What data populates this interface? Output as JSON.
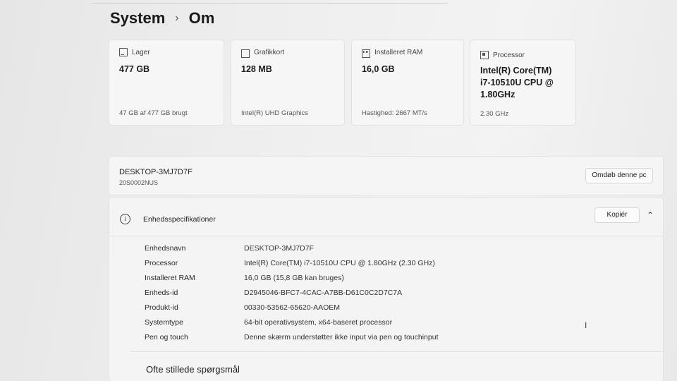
{
  "breadcrumb": {
    "parent": "System",
    "separator": "›",
    "current": "Om"
  },
  "cards": [
    {
      "icon": "drive-icon",
      "label": "Lager",
      "value": "477 GB",
      "sub": "47 GB af 477 GB brugt"
    },
    {
      "icon": "gpu-icon",
      "label": "Grafikkort",
      "value": "128 MB",
      "sub": "Intel(R) UHD Graphics"
    },
    {
      "icon": "ram-icon",
      "label": "Installeret RAM",
      "value": "16,0 GB",
      "sub": "Hastighed: 2667 MT/s"
    },
    {
      "icon": "cpu-icon",
      "label": "Processor",
      "value_lines": [
        "Intel(R) Core(TM)",
        "i7-10510U CPU @",
        "1.80GHz"
      ],
      "sub": "2.30 GHz"
    }
  ],
  "device": {
    "name": "DESKTOP-3MJ7D7F",
    "model": "20S0002NUS",
    "rename_label": "Omdøb denne pc"
  },
  "specs": {
    "title": "Enhedsspecifikationer",
    "copy_label": "Kopiér",
    "rows": [
      {
        "key": "Enhedsnavn",
        "value": "DESKTOP-3MJ7D7F"
      },
      {
        "key": "Processor",
        "value": "Intel(R) Core(TM) i7-10510U CPU @ 1.80GHz (2.30 GHz)"
      },
      {
        "key": "Installeret RAM",
        "value": "16,0 GB (15,8 GB kan bruges)"
      },
      {
        "key": "Enheds-id",
        "value": "D2945046-BFC7-4CAC-A7BB-D61C0C2D7C7A"
      },
      {
        "key": "Produkt-id",
        "value": "00330-53562-65620-AAOEM"
      },
      {
        "key": "Systemtype",
        "value": "64-bit operativsystem, x64-baseret processor"
      },
      {
        "key": "Pen og touch",
        "value": "Denne skærm understøtter ikke input via pen og touchinput"
      }
    ]
  },
  "faq": {
    "title": "Ofte stillede spørgsmål"
  }
}
